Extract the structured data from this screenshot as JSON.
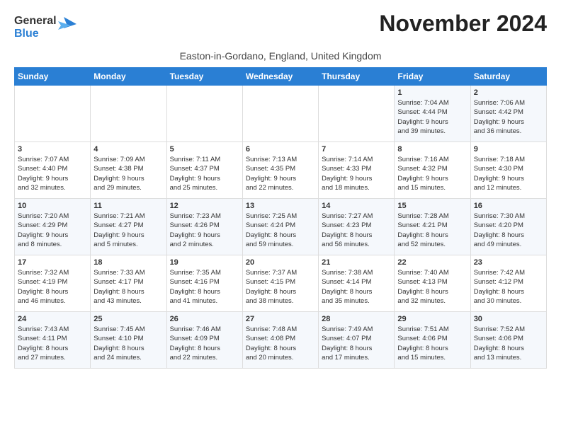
{
  "logo": {
    "line1": "General",
    "line2": "Blue"
  },
  "title": "November 2024",
  "subtitle": "Easton-in-Gordano, England, United Kingdom",
  "days_header": [
    "Sunday",
    "Monday",
    "Tuesday",
    "Wednesday",
    "Thursday",
    "Friday",
    "Saturday"
  ],
  "weeks": [
    [
      {
        "day": "",
        "info": ""
      },
      {
        "day": "",
        "info": ""
      },
      {
        "day": "",
        "info": ""
      },
      {
        "day": "",
        "info": ""
      },
      {
        "day": "",
        "info": ""
      },
      {
        "day": "1",
        "info": "Sunrise: 7:04 AM\nSunset: 4:44 PM\nDaylight: 9 hours\nand 39 minutes."
      },
      {
        "day": "2",
        "info": "Sunrise: 7:06 AM\nSunset: 4:42 PM\nDaylight: 9 hours\nand 36 minutes."
      }
    ],
    [
      {
        "day": "3",
        "info": "Sunrise: 7:07 AM\nSunset: 4:40 PM\nDaylight: 9 hours\nand 32 minutes."
      },
      {
        "day": "4",
        "info": "Sunrise: 7:09 AM\nSunset: 4:38 PM\nDaylight: 9 hours\nand 29 minutes."
      },
      {
        "day": "5",
        "info": "Sunrise: 7:11 AM\nSunset: 4:37 PM\nDaylight: 9 hours\nand 25 minutes."
      },
      {
        "day": "6",
        "info": "Sunrise: 7:13 AM\nSunset: 4:35 PM\nDaylight: 9 hours\nand 22 minutes."
      },
      {
        "day": "7",
        "info": "Sunrise: 7:14 AM\nSunset: 4:33 PM\nDaylight: 9 hours\nand 18 minutes."
      },
      {
        "day": "8",
        "info": "Sunrise: 7:16 AM\nSunset: 4:32 PM\nDaylight: 9 hours\nand 15 minutes."
      },
      {
        "day": "9",
        "info": "Sunrise: 7:18 AM\nSunset: 4:30 PM\nDaylight: 9 hours\nand 12 minutes."
      }
    ],
    [
      {
        "day": "10",
        "info": "Sunrise: 7:20 AM\nSunset: 4:29 PM\nDaylight: 9 hours\nand 8 minutes."
      },
      {
        "day": "11",
        "info": "Sunrise: 7:21 AM\nSunset: 4:27 PM\nDaylight: 9 hours\nand 5 minutes."
      },
      {
        "day": "12",
        "info": "Sunrise: 7:23 AM\nSunset: 4:26 PM\nDaylight: 9 hours\nand 2 minutes."
      },
      {
        "day": "13",
        "info": "Sunrise: 7:25 AM\nSunset: 4:24 PM\nDaylight: 8 hours\nand 59 minutes."
      },
      {
        "day": "14",
        "info": "Sunrise: 7:27 AM\nSunset: 4:23 PM\nDaylight: 8 hours\nand 56 minutes."
      },
      {
        "day": "15",
        "info": "Sunrise: 7:28 AM\nSunset: 4:21 PM\nDaylight: 8 hours\nand 52 minutes."
      },
      {
        "day": "16",
        "info": "Sunrise: 7:30 AM\nSunset: 4:20 PM\nDaylight: 8 hours\nand 49 minutes."
      }
    ],
    [
      {
        "day": "17",
        "info": "Sunrise: 7:32 AM\nSunset: 4:19 PM\nDaylight: 8 hours\nand 46 minutes."
      },
      {
        "day": "18",
        "info": "Sunrise: 7:33 AM\nSunset: 4:17 PM\nDaylight: 8 hours\nand 43 minutes."
      },
      {
        "day": "19",
        "info": "Sunrise: 7:35 AM\nSunset: 4:16 PM\nDaylight: 8 hours\nand 41 minutes."
      },
      {
        "day": "20",
        "info": "Sunrise: 7:37 AM\nSunset: 4:15 PM\nDaylight: 8 hours\nand 38 minutes."
      },
      {
        "day": "21",
        "info": "Sunrise: 7:38 AM\nSunset: 4:14 PM\nDaylight: 8 hours\nand 35 minutes."
      },
      {
        "day": "22",
        "info": "Sunrise: 7:40 AM\nSunset: 4:13 PM\nDaylight: 8 hours\nand 32 minutes."
      },
      {
        "day": "23",
        "info": "Sunrise: 7:42 AM\nSunset: 4:12 PM\nDaylight: 8 hours\nand 30 minutes."
      }
    ],
    [
      {
        "day": "24",
        "info": "Sunrise: 7:43 AM\nSunset: 4:11 PM\nDaylight: 8 hours\nand 27 minutes."
      },
      {
        "day": "25",
        "info": "Sunrise: 7:45 AM\nSunset: 4:10 PM\nDaylight: 8 hours\nand 24 minutes."
      },
      {
        "day": "26",
        "info": "Sunrise: 7:46 AM\nSunset: 4:09 PM\nDaylight: 8 hours\nand 22 minutes."
      },
      {
        "day": "27",
        "info": "Sunrise: 7:48 AM\nSunset: 4:08 PM\nDaylight: 8 hours\nand 20 minutes."
      },
      {
        "day": "28",
        "info": "Sunrise: 7:49 AM\nSunset: 4:07 PM\nDaylight: 8 hours\nand 17 minutes."
      },
      {
        "day": "29",
        "info": "Sunrise: 7:51 AM\nSunset: 4:06 PM\nDaylight: 8 hours\nand 15 minutes."
      },
      {
        "day": "30",
        "info": "Sunrise: 7:52 AM\nSunset: 4:06 PM\nDaylight: 8 hours\nand 13 minutes."
      }
    ]
  ]
}
